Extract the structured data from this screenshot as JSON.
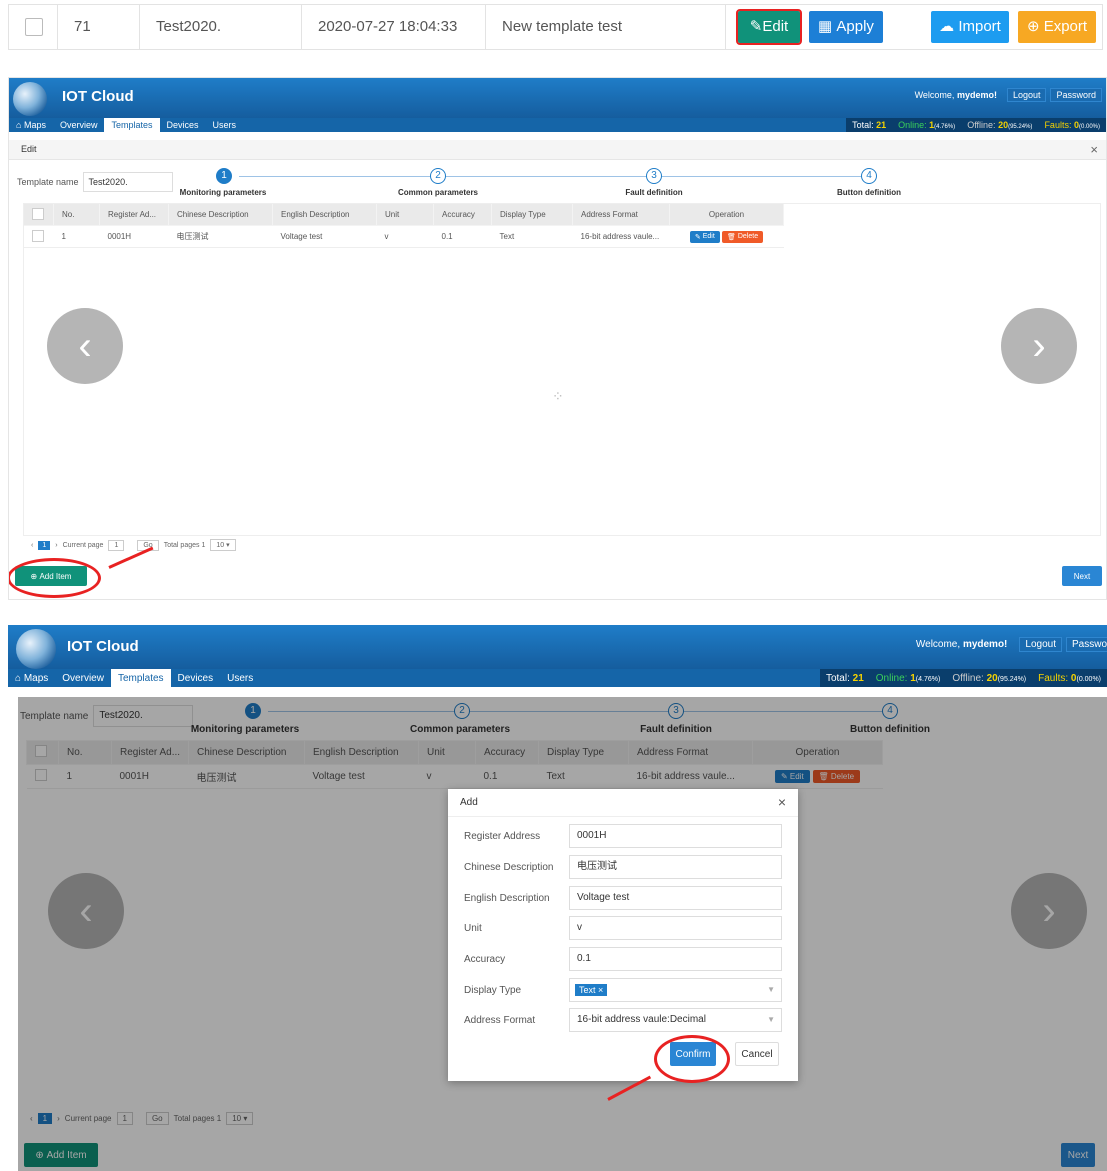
{
  "top_row": {
    "id": "71",
    "name": "Test2020.",
    "date": "2020-07-27 18:04:33",
    "desc": "New template test",
    "edit": "Edit",
    "apply": "Apply",
    "import": "Import",
    "export": "Export"
  },
  "app": {
    "title": "IOT Cloud",
    "welcome": "Welcome,",
    "user": "mydemo!",
    "logout": "Logout",
    "password": "Password",
    "password_cut": "Passwo"
  },
  "nav": {
    "maps": "Maps",
    "overview": "Overview",
    "templates": "Templates",
    "devices": "Devices",
    "users": "Users"
  },
  "stats": {
    "total_label": "Total:",
    "total": "21",
    "online_label": "Online:",
    "online": "1",
    "online_pct": "(4.76%)",
    "offline_label": "Offline:",
    "offline": "20",
    "offline_pct": "(95.24%)",
    "faults_label": "Faults:",
    "faults": "0",
    "faults_pct": "(0.00%)"
  },
  "edit_bar": {
    "title": "Edit",
    "close": "×"
  },
  "template": {
    "label": "Template name",
    "value": "Test2020."
  },
  "steps": [
    {
      "n": "1",
      "label": "Monitoring parameters"
    },
    {
      "n": "2",
      "label": "Common parameters"
    },
    {
      "n": "3",
      "label": "Fault definition"
    },
    {
      "n": "4",
      "label": "Button definition"
    }
  ],
  "table": {
    "headers": [
      "No.",
      "Register Ad...",
      "Chinese Description",
      "English Description",
      "Unit",
      "Accuracy",
      "Display Type",
      "Address Format",
      "Operation"
    ],
    "row": {
      "no": "1",
      "reg": "0001H",
      "cn": "电压测试",
      "en": "Voltage test",
      "unit": "v",
      "acc": "0.1",
      "type": "Text",
      "fmt": "16-bit address vaule..."
    },
    "edit": "Edit",
    "delete": "Delete"
  },
  "pager": {
    "current_label": "Current page",
    "page": "1",
    "go": "Go",
    "total_label": "Total pages 1",
    "size": "10"
  },
  "buttons": {
    "add_item": "Add Item",
    "next": "Next"
  },
  "modal": {
    "title": "Add",
    "close": "×",
    "fields": [
      {
        "label": "Register Address",
        "value": "0001H"
      },
      {
        "label": "Chinese Description",
        "value": "电压测试"
      },
      {
        "label": "English Description",
        "value": "Voltage test"
      },
      {
        "label": "Unit",
        "value": "v"
      },
      {
        "label": "Accuracy",
        "value": "0.1"
      }
    ],
    "display_type": {
      "label": "Display Type",
      "tag": "Text"
    },
    "address_format": {
      "label": "Address Format",
      "value": "16-bit address vaule:Decimal"
    },
    "confirm": "Confirm",
    "cancel": "Cancel"
  },
  "colors": {
    "header": "#1f7dc8",
    "green": "#10927a",
    "blue": "#2a86d4",
    "orange": "#f7a823",
    "red": "#e82222"
  }
}
